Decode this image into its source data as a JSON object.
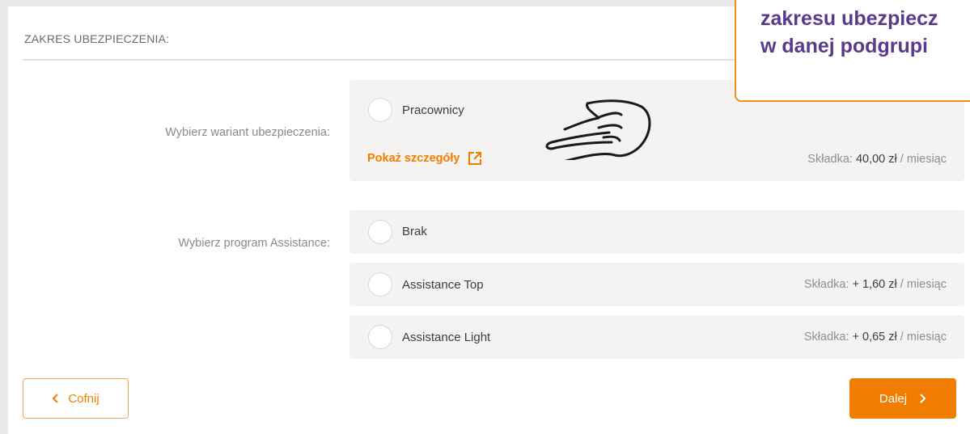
{
  "section": {
    "title": "ZAKRES UBEZPIECZENIA:"
  },
  "variant": {
    "label": "Wybierz wariant ubezpieczenia:",
    "option": {
      "name": "Pracownicy",
      "details_link": "Pokaż szczegóły",
      "premium_label": "Składka:",
      "premium_amount": "40,00 zł",
      "premium_period": "/ miesiąc"
    }
  },
  "assistance": {
    "label": "Wybierz program Assistance:",
    "options": [
      {
        "name": "Brak"
      },
      {
        "name": "Assistance Top",
        "premium_label": "Składka:",
        "premium_amount": "+ 1,60 zł",
        "premium_period": "/ miesiąc"
      },
      {
        "name": "Assistance Light",
        "premium_label": "Składka:",
        "premium_amount": "+ 0,65 zł",
        "premium_period": "/ miesiąc"
      }
    ]
  },
  "buttons": {
    "back": "Cofnij",
    "next": "Dalej"
  },
  "callout": {
    "line1": "zakresu ubezpiecz",
    "line2": "w danej podgrupi"
  },
  "icons": {
    "back": "chevron-left-icon",
    "next": "chevron-right-icon",
    "external": "external-link-icon",
    "hand": "pointing-hand-icon"
  },
  "colors": {
    "accent": "#f07d00",
    "callout_text": "#5a3a8a",
    "option_bg": "#f4f3f1"
  }
}
